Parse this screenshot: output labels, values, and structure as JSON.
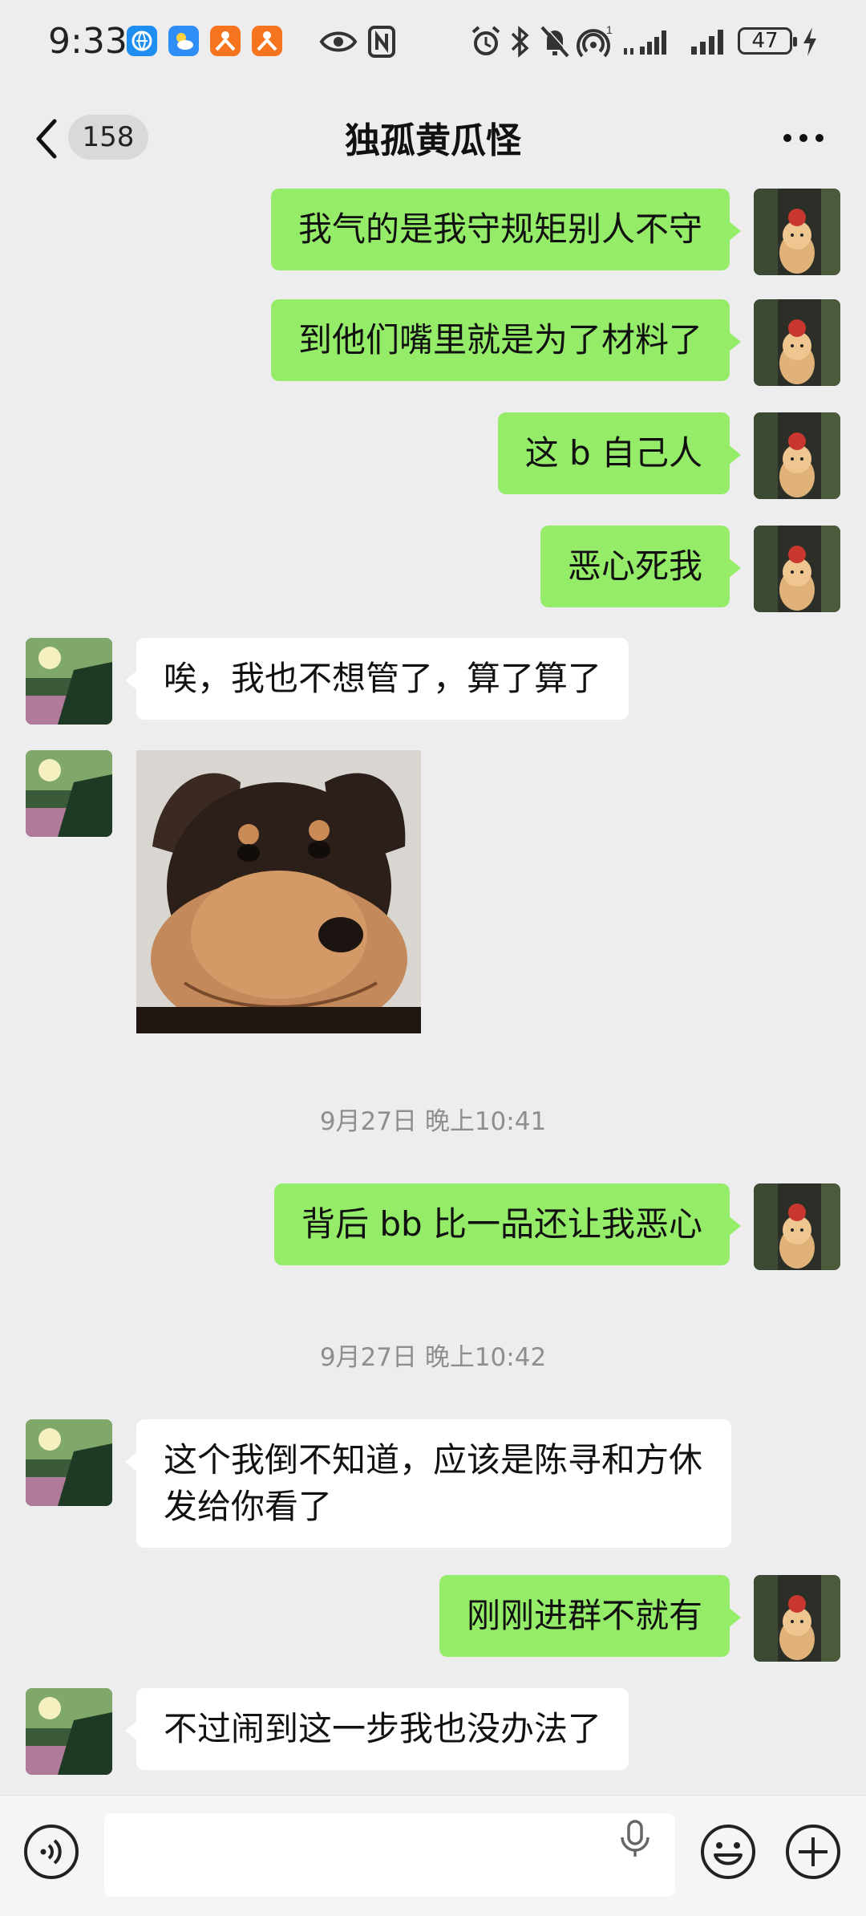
{
  "status_bar": {
    "time": "9:33",
    "battery": "47",
    "signal_superscript": "1"
  },
  "header": {
    "unread_count": "158",
    "title": "独孤黄瓜怪"
  },
  "messages": [
    {
      "side": "me",
      "type": "text",
      "text": "我气的是我守规矩别人不守"
    },
    {
      "side": "me",
      "type": "text",
      "text": "到他们嘴里就是为了材料了"
    },
    {
      "side": "me",
      "type": "text",
      "text": "这 b 自己人"
    },
    {
      "side": "me",
      "type": "text",
      "text": "恶心死我"
    },
    {
      "side": "peer",
      "type": "text",
      "text": "唉，我也不想管了，算了算了"
    },
    {
      "side": "peer",
      "type": "sticker",
      "sticker": "dog-face-sticker"
    },
    {
      "type": "timestamp",
      "text": "9月27日 晚上10:41"
    },
    {
      "side": "me",
      "type": "text",
      "text": "背后 bb 比一品还让我恶心"
    },
    {
      "type": "timestamp",
      "text": "9月27日 晚上10:42"
    },
    {
      "side": "peer",
      "type": "text",
      "text": "这个我倒不知道，应该是陈寻和方休发给你看了"
    },
    {
      "side": "me",
      "type": "text",
      "text": "刚刚进群不就有"
    },
    {
      "side": "peer",
      "type": "text",
      "text": "不过闹到这一步我也没办法了"
    }
  ],
  "input_bar": {
    "value": "",
    "icons": [
      "voice-icon",
      "mic-icon",
      "emoji-icon",
      "plus-icon"
    ]
  },
  "colors": {
    "background": "#ededed",
    "my_bubble": "#95ec69",
    "peer_bubble": "#ffffff",
    "timestamp": "#8e8e8e"
  }
}
